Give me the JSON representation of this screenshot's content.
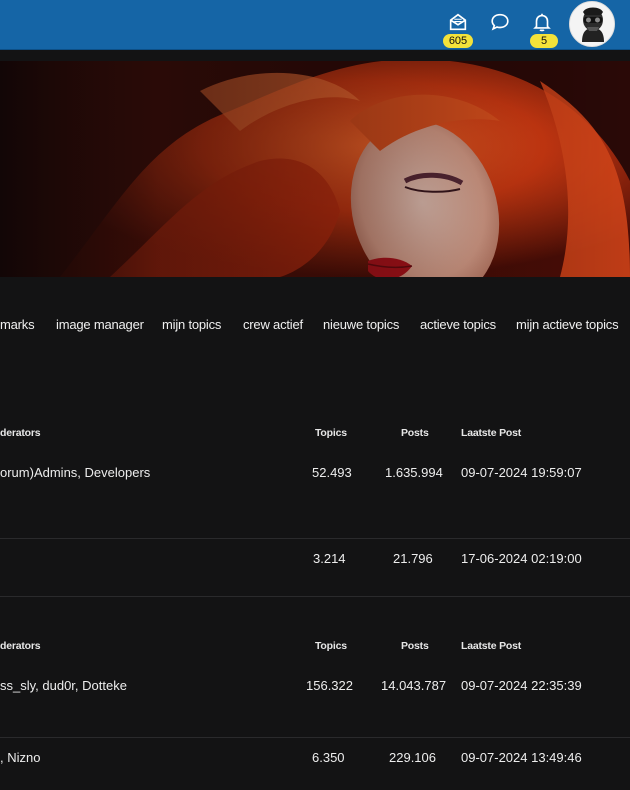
{
  "topbar": {
    "messages_badge": "605",
    "notifications_badge": "5",
    "colors": {
      "bar": "#1565a6",
      "badge": "#f3e23a"
    }
  },
  "nav": {
    "items": [
      "marks",
      "image manager",
      "mijn topics",
      "crew actief",
      "nieuwe topics",
      "actieve topics",
      "mijn actieve topics"
    ]
  },
  "section1": {
    "header": {
      "moderators": "derators",
      "topics": "Topics",
      "posts": "Posts",
      "last_post": "Laatste Post"
    },
    "rows": [
      {
        "moderators": "orum)Admins, Developers",
        "topics": "52.493",
        "posts": "1.635.994",
        "last_post": "09-07-2024 19:59:07"
      },
      {
        "moderators": "",
        "topics": "3.214",
        "posts": "21.796",
        "last_post": "17-06-2024 02:19:00"
      }
    ]
  },
  "section2": {
    "header": {
      "moderators": "derators",
      "topics": "Topics",
      "posts": "Posts",
      "last_post": "Laatste Post"
    },
    "rows": [
      {
        "moderators": "ss_sly, dud0r, Dotteke",
        "topics": "156.322",
        "posts": "14.043.787",
        "last_post": "09-07-2024 22:35:39"
      },
      {
        "moderators": ", Nizno",
        "topics": "6.350",
        "posts": "229.106",
        "last_post": "09-07-2024 13:49:46"
      }
    ]
  }
}
